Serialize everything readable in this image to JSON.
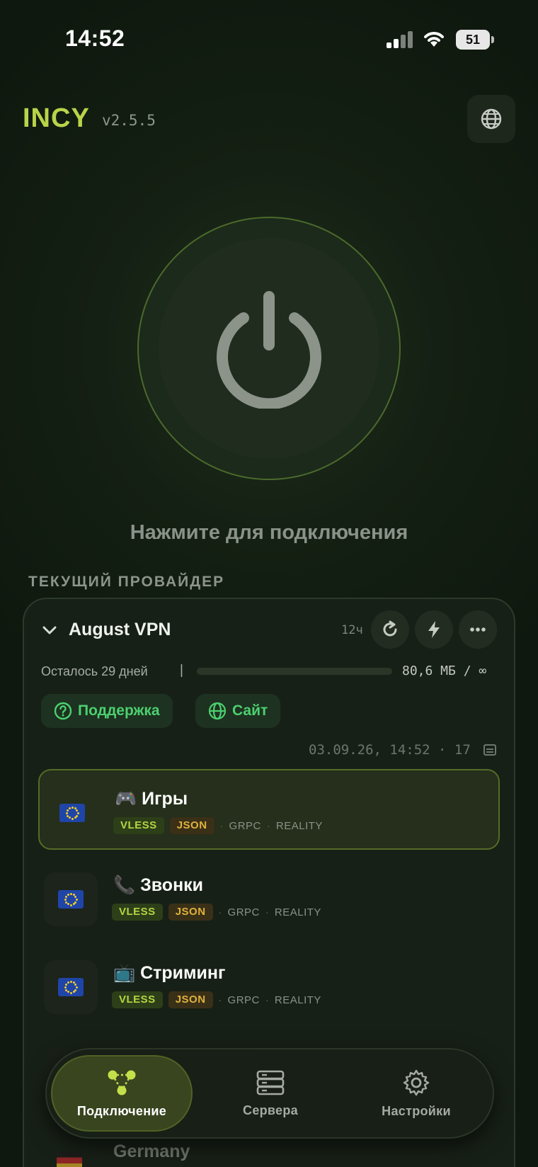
{
  "status_bar": {
    "time": "14:52",
    "battery": "51"
  },
  "header": {
    "brand": "INCY",
    "version": "v2.5.5"
  },
  "power": {
    "hint": "Нажмите для подключения"
  },
  "provider_section": {
    "label": "ТЕКУЩИЙ ПРОВАЙДЕР"
  },
  "provider": {
    "name": "August VPN",
    "update_interval": "12ч",
    "remaining": "Осталось 29 дней",
    "separator": "|",
    "usage": "80,6 МБ / ∞",
    "usage_fraction": 0,
    "support_label": "Поддержка",
    "site_label": "Сайт",
    "updated": "03.09.26, 14:52 · 17"
  },
  "servers": [
    {
      "emoji": "🎮",
      "name": "Игры",
      "tags": [
        "VLESS",
        "JSON"
      ],
      "transport": "GRPC",
      "security": "REALITY",
      "active": true
    },
    {
      "emoji": "📞",
      "name": "Звонки",
      "tags": [
        "VLESS",
        "JSON"
      ],
      "transport": "GRPC",
      "security": "REALITY",
      "active": false
    },
    {
      "emoji": "📺",
      "name": "Стриминг",
      "tags": [
        "VLESS",
        "JSON"
      ],
      "transport": "GRPC",
      "security": "REALITY",
      "active": false
    }
  ],
  "partial_server": {
    "name": "Germany"
  },
  "nav": {
    "connection": "Подключение",
    "servers": "Сервера",
    "settings": "Настройки"
  },
  "colors": {
    "accent": "#b9d34a",
    "support_green": "#4cd06f",
    "background": "#0f1a0f"
  }
}
